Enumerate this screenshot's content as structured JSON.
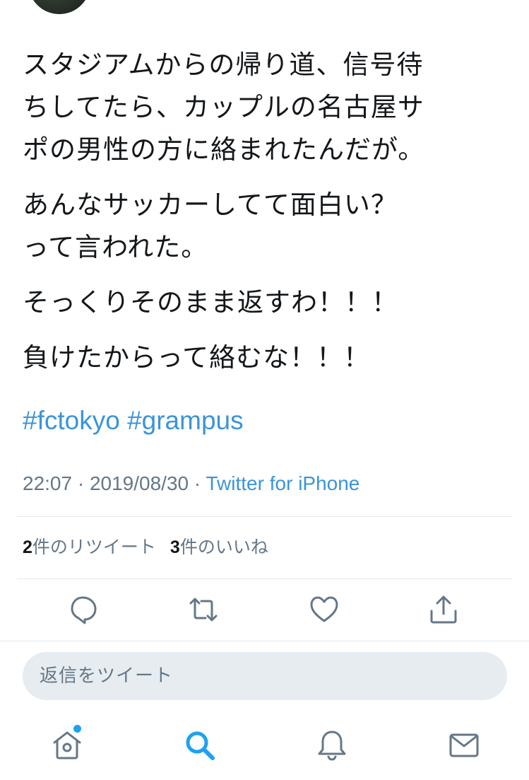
{
  "tweet": {
    "paragraphs": [
      [
        "スタジアムからの帰り道、信号待",
        "ちしてたら、カップルの名古屋サ",
        "ポの男性の方に絡まれたんだが。"
      ],
      [
        "あんなサッカーしてて面白い？",
        "って言われた。"
      ],
      [
        "そっくりそのまま返すわ！！！"
      ],
      [
        "負けたからって絡むな！！！"
      ]
    ],
    "hashtags": [
      "#fctokyo",
      "#grampus"
    ],
    "time": "22:07",
    "date": "2019/08/30",
    "separator": "·",
    "source": "Twitter for iPhone"
  },
  "stats": {
    "retweets_count": "2",
    "retweets_label": "件のリツイート",
    "likes_count": "3",
    "likes_label": "件のいいね"
  },
  "actions": [
    "reply-icon",
    "retweet-icon",
    "like-icon",
    "share-icon"
  ],
  "reply_box": {
    "placeholder": "返信をツイート"
  },
  "tabbar": {
    "tabs": [
      "home-icon",
      "search-icon",
      "notifications-icon",
      "messages-icon"
    ],
    "active": "search-icon"
  },
  "colors": {
    "accent": "#3b94d9",
    "text": "#14171a",
    "muted": "#657786",
    "divider": "#e1e8ed",
    "input_bg": "#e6ecf0"
  }
}
